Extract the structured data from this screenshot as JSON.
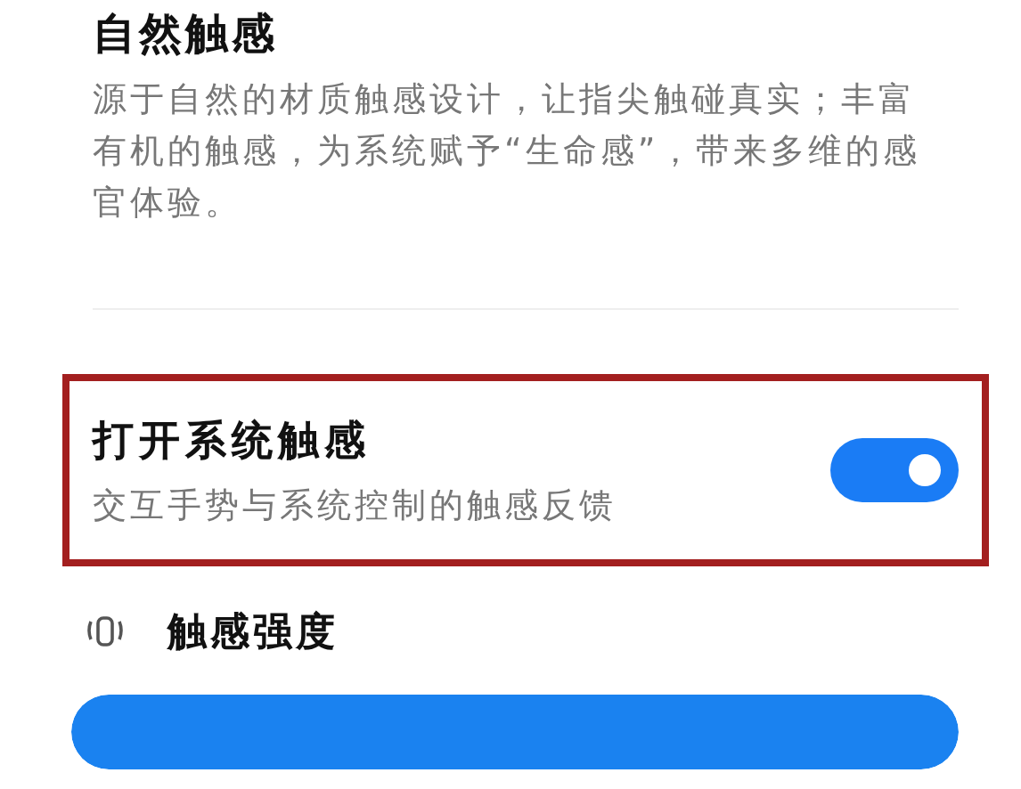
{
  "section": {
    "title": "自然触感",
    "description": "源于自然的材质触感设计，让指尖触碰真实；丰富有机的触感，为系统赋予“生命感”，带来多维的感官体验。"
  },
  "setting": {
    "title": "打开系统触感",
    "subtitle": "交互手势与系统控制的触感反馈",
    "on": true,
    "highlighted": true
  },
  "intensity": {
    "label": "触感强度"
  }
}
